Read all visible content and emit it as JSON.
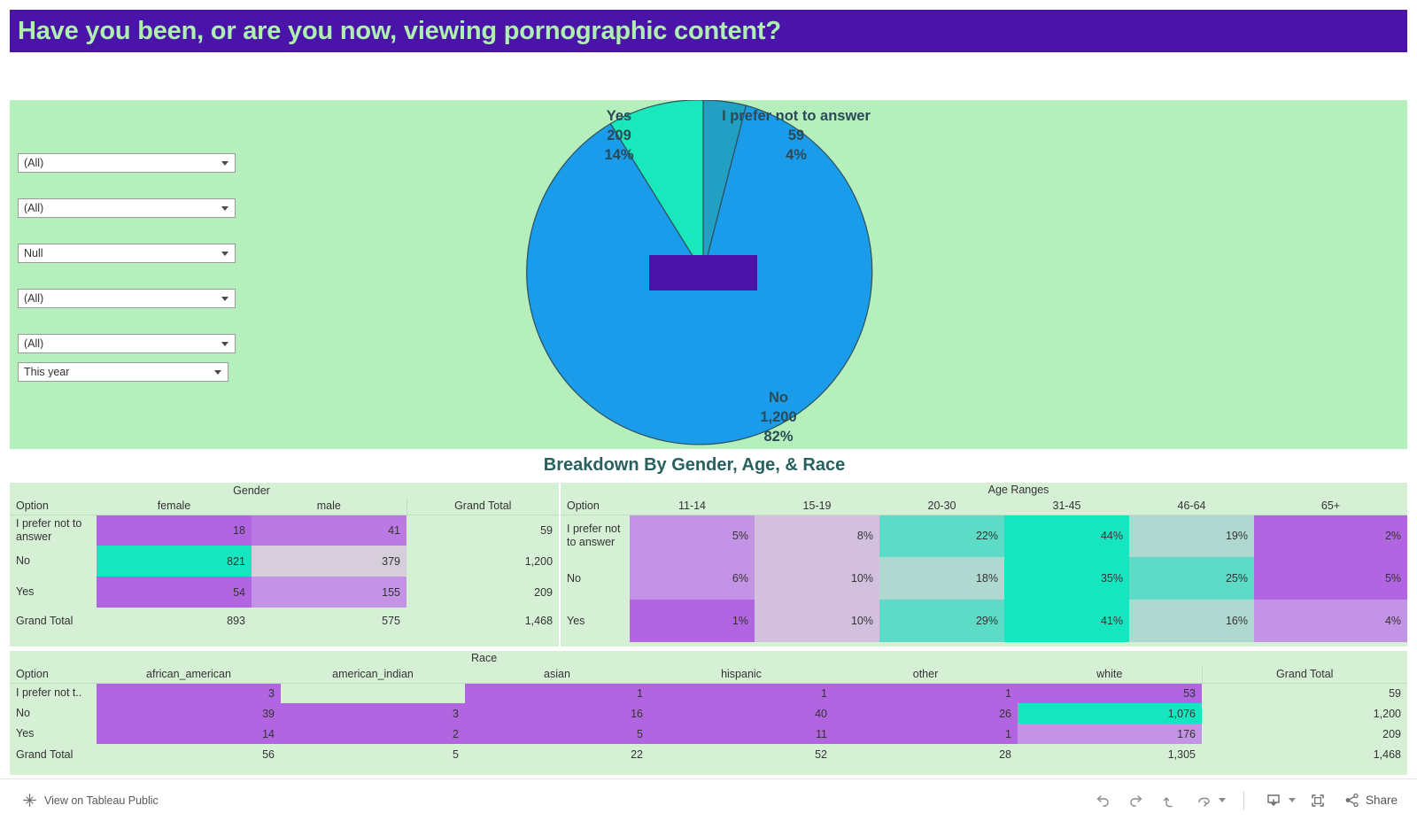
{
  "header": {
    "title": "Have you been, or are you now, viewing pornographic content?",
    "bg_color": "#4B14A8",
    "text_color": "#AEF0B0"
  },
  "dashboard": {
    "background": "#B5F0BC",
    "table_background": "#D6F0D6"
  },
  "filters": [
    {
      "name": "filter-1",
      "value": "(All)"
    },
    {
      "name": "filter-2",
      "value": "(All)"
    },
    {
      "name": "filter-3",
      "value": "Null"
    },
    {
      "name": "filter-4",
      "value": "(All)"
    },
    {
      "name": "filter-5",
      "value": "(All)"
    },
    {
      "name": "filter-date",
      "value": "This year"
    }
  ],
  "chart_data": {
    "type": "pie",
    "title": "Have you been, or are you now, viewing pornographic content?",
    "categories": [
      "I prefer not to answer",
      "No",
      "Yes"
    ],
    "values": [
      59,
      1200,
      209
    ],
    "percents": [
      "4%",
      "82%",
      "14%"
    ],
    "labels": [
      {
        "name": "I prefer not to answer",
        "value": "59",
        "percent": "4%",
        "color": "#21A0C4"
      },
      {
        "name": "No",
        "value": "1,200",
        "percent": "82%",
        "color": "#1A9CEB"
      },
      {
        "name": "Yes",
        "value": "209",
        "percent": "14%",
        "color": "#18E8BC"
      }
    ],
    "total": 1468,
    "legend": "labels-on-slices",
    "grid": false
  },
  "breakdown": {
    "title": "Breakdown By Gender, Age, & Race"
  },
  "gender_table": {
    "group_header": "Gender",
    "option_header": "Option",
    "columns": [
      "female",
      "male"
    ],
    "grand_total_header": "Grand Total",
    "rows": [
      {
        "option": "I prefer not to answer",
        "cells": [
          "18",
          "41"
        ],
        "grand_total": "59",
        "colors": [
          "#B165E0",
          "#BB79E3"
        ]
      },
      {
        "option": "No",
        "cells": [
          "821",
          "379"
        ],
        "grand_total": "1,200",
        "colors": [
          "#16E6C0",
          "#D6CEDA"
        ]
      },
      {
        "option": "Yes",
        "cells": [
          "54",
          "155"
        ],
        "grand_total": "209",
        "colors": [
          "#B165E0",
          "#C394E6"
        ]
      }
    ],
    "total_row": {
      "option": "Grand Total",
      "cells": [
        "893",
        "575"
      ],
      "grand_total": "1,468"
    }
  },
  "age_table": {
    "group_header": "Age Ranges",
    "option_header": "Option",
    "columns": [
      "11-14",
      "15-19",
      "20-30",
      "31-45",
      "46-64",
      "65+"
    ],
    "rows": [
      {
        "option": "I prefer not to answer",
        "cells": [
          "5%",
          "8%",
          "22%",
          "44%",
          "19%",
          "2%"
        ],
        "colors": [
          "#C393E5",
          "#D3C0DF",
          "#5CDCC6",
          "#16E6C0",
          "#AFD9D0",
          "#B165E0"
        ]
      },
      {
        "option": "No",
        "cells": [
          "6%",
          "10%",
          "18%",
          "35%",
          "25%",
          "5%"
        ],
        "colors": [
          "#C393E5",
          "#D3C0DF",
          "#AFD9D0",
          "#16E6C0",
          "#5CDCC6",
          "#B165E0"
        ]
      },
      {
        "option": "Yes",
        "cells": [
          "1%",
          "10%",
          "29%",
          "41%",
          "16%",
          "4%"
        ],
        "colors": [
          "#B165E0",
          "#D3C0DF",
          "#5CDCC6",
          "#16E6C0",
          "#AFD9D0",
          "#C393E5"
        ]
      }
    ]
  },
  "race_table": {
    "group_header": "Race",
    "option_header": "Option",
    "columns": [
      "african_american",
      "american_indian",
      "asian",
      "hispanic",
      "other",
      "white"
    ],
    "grand_total_header": "Grand Total",
    "rows": [
      {
        "option": "I prefer not t..",
        "cells": [
          "3",
          "",
          "1",
          "1",
          "1",
          "53"
        ],
        "grand_total": "59",
        "colors": [
          "#B165E0",
          "#D6F0D6",
          "#B165E0",
          "#B165E0",
          "#B165E0",
          "#B165E0"
        ]
      },
      {
        "option": "No",
        "cells": [
          "39",
          "3",
          "16",
          "40",
          "26",
          "1,076"
        ],
        "grand_total": "1,200",
        "colors": [
          "#B165E0",
          "#B165E0",
          "#B165E0",
          "#B165E0",
          "#B165E0",
          "#16E6C0"
        ]
      },
      {
        "option": "Yes",
        "cells": [
          "14",
          "2",
          "5",
          "11",
          "1",
          "176"
        ],
        "grand_total": "209",
        "colors": [
          "#B165E0",
          "#B165E0",
          "#B165E0",
          "#B165E0",
          "#B165E0",
          "#C393E5"
        ]
      }
    ],
    "total_row": {
      "option": "Grand Total",
      "cells": [
        "56",
        "5",
        "22",
        "52",
        "28",
        "1,305"
      ],
      "grand_total": "1,468"
    }
  },
  "toolbar": {
    "tableau_public_label": "View on Tableau Public",
    "share_label": "Share",
    "buttons": [
      {
        "name": "undo",
        "label": "Undo"
      },
      {
        "name": "redo",
        "label": "Redo"
      },
      {
        "name": "revert",
        "label": "Revert"
      },
      {
        "name": "refresh",
        "label": "Refresh"
      },
      {
        "name": "pause",
        "label": "Pause"
      },
      {
        "name": "download",
        "label": "Download"
      },
      {
        "name": "fullscreen",
        "label": "Full Screen"
      }
    ]
  }
}
